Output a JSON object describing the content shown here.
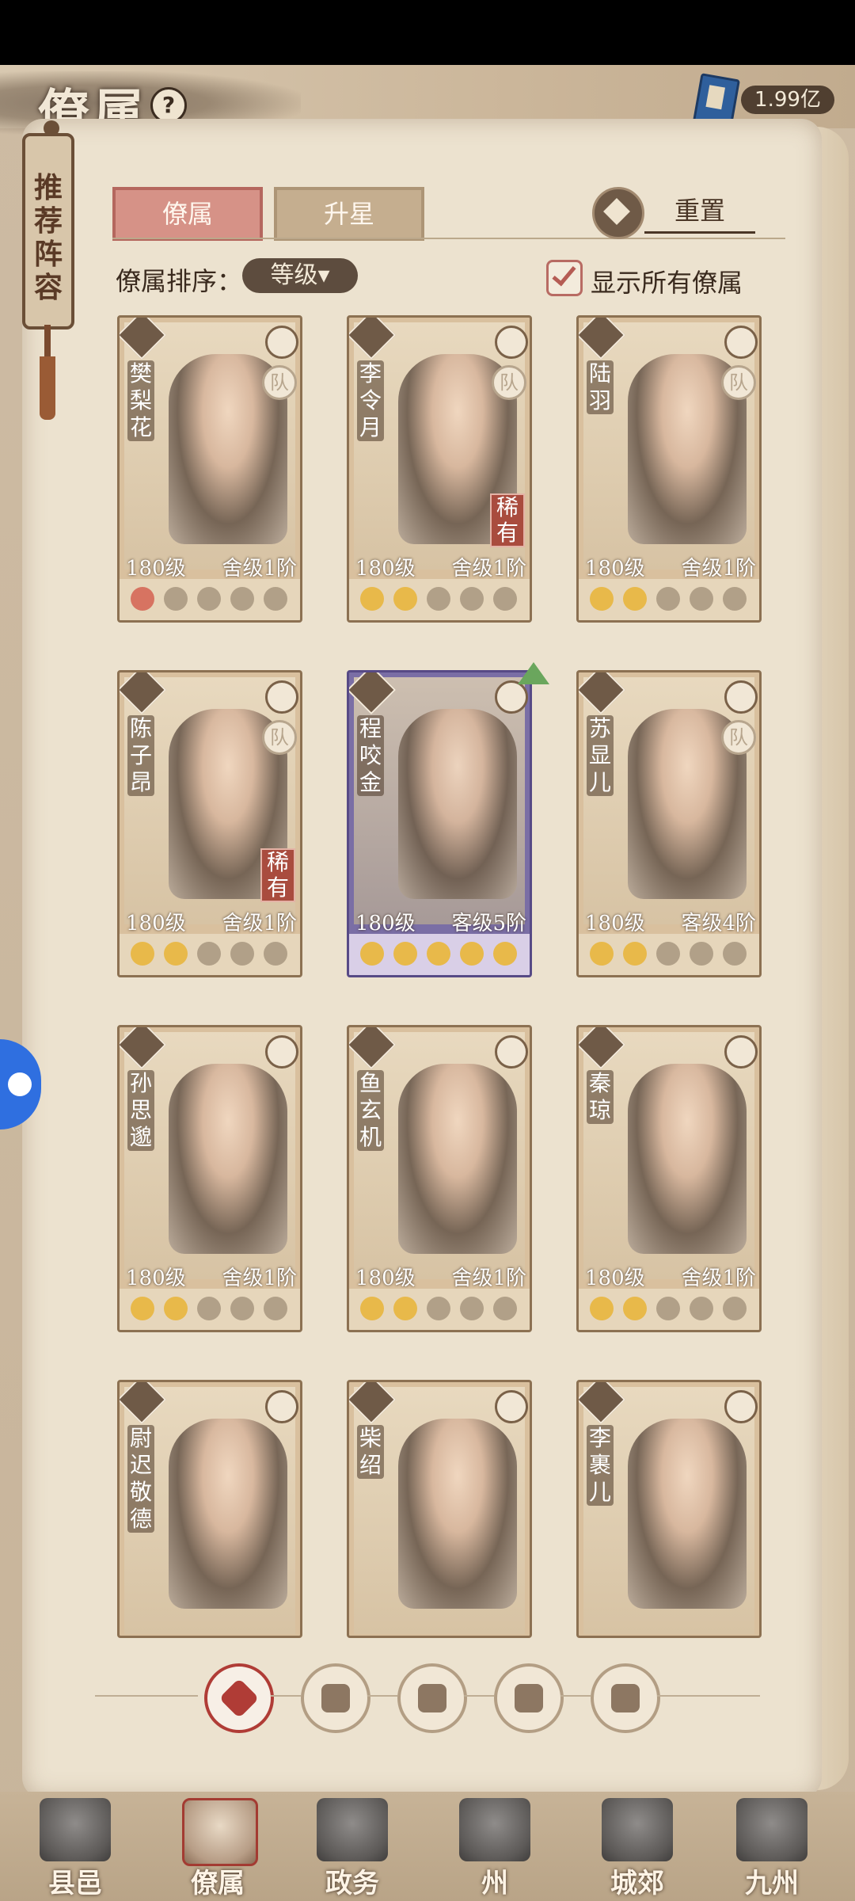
{
  "header": {
    "title": "僚属",
    "help_icon": "question-circle-icon",
    "currency": {
      "icon": "blue-book-icon",
      "value": "1.99亿"
    }
  },
  "side_scroll": {
    "label": "推荐阵容"
  },
  "tabs": [
    {
      "label": "僚属",
      "active": true
    },
    {
      "label": "升星",
      "active": false
    }
  ],
  "reset_label": "重置",
  "sort": {
    "label": "僚属排序：",
    "selected": "等级▾"
  },
  "show_all": {
    "label": "显示所有僚属",
    "checked": true
  },
  "cards": [
    {
      "name": "樊梨花",
      "level": "180级",
      "rank": "舍级1阶",
      "team": "队",
      "rarity": "",
      "moons": 1,
      "moon_color": "red"
    },
    {
      "name": "李令月",
      "level": "180级",
      "rank": "舍级1阶",
      "team": "队",
      "rarity": "稀有",
      "moons": 2,
      "moon_color": "gold"
    },
    {
      "name": "陆羽",
      "level": "180级",
      "rank": "舍级1阶",
      "team": "队",
      "rarity": "",
      "moons": 2,
      "moon_color": "gold"
    },
    {
      "name": "陈子昂",
      "level": "180级",
      "rank": "舍级1阶",
      "team": "队",
      "rarity": "稀有",
      "moons": 2,
      "moon_color": "gold"
    },
    {
      "name": "程咬金",
      "level": "180级",
      "rank": "客级5阶",
      "team": "",
      "rarity": "",
      "moons": 5,
      "moon_color": "gold"
    },
    {
      "name": "苏显儿",
      "level": "180级",
      "rank": "客级4阶",
      "team": "队",
      "rarity": "",
      "moons": 2,
      "moon_color": "gold"
    },
    {
      "name": "孙思邈",
      "level": "180级",
      "rank": "舍级1阶",
      "team": "",
      "rarity": "",
      "moons": 2,
      "moon_color": "gold"
    },
    {
      "name": "鱼玄机",
      "level": "180级",
      "rank": "舍级1阶",
      "team": "",
      "rarity": "",
      "moons": 2,
      "moon_color": "gold"
    },
    {
      "name": "秦琼",
      "level": "180级",
      "rank": "舍级1阶",
      "team": "",
      "rarity": "",
      "moons": 2,
      "moon_color": "gold"
    },
    {
      "name": "尉迟敬德",
      "level": "",
      "rank": "",
      "team": "",
      "rarity": "",
      "moons": 0,
      "moon_color": "gold"
    },
    {
      "name": "柴绍",
      "level": "",
      "rank": "",
      "team": "",
      "rarity": "",
      "moons": 0,
      "moon_color": "gold"
    },
    {
      "name": "李裹儿",
      "level": "",
      "rank": "",
      "team": "",
      "rarity": "",
      "moons": 0,
      "moon_color": "gold"
    }
  ],
  "filters": [
    {
      "icon": "diamond-filter-icon",
      "active": true
    },
    {
      "icon": "lantern-filter-icon",
      "active": false
    },
    {
      "icon": "coin-filter-icon",
      "active": false
    },
    {
      "icon": "fan-filter-icon",
      "active": false
    },
    {
      "icon": "lion-filter-icon",
      "active": false
    }
  ],
  "bottom_nav": [
    {
      "label": "县邑",
      "active": false
    },
    {
      "label": "僚属",
      "active": true
    },
    {
      "label": "政务",
      "active": false
    },
    {
      "label": "州",
      "active": false
    },
    {
      "label": "城郊",
      "active": false
    },
    {
      "label": "九州",
      "active": false
    }
  ]
}
